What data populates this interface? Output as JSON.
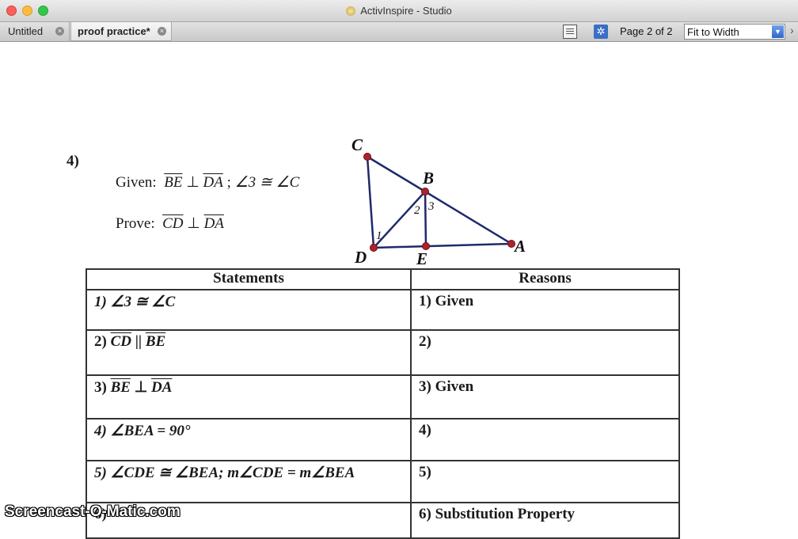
{
  "window": {
    "title": "ActivInspire - Studio"
  },
  "tabs": [
    {
      "label": "Untitled"
    },
    {
      "label": "proof practice*"
    }
  ],
  "toolbar": {
    "page_label": "Page 2 of 2",
    "zoom_value": "Fit to Width"
  },
  "worksheet": {
    "problem_number": "4)",
    "given": {
      "label": "Given:",
      "seg1": "BE",
      "perp": "⊥",
      "seg2": "DA",
      "sep": ";",
      "angle": "∠3 ≅ ∠C"
    },
    "prove": {
      "label": "Prove:",
      "seg1": "CD",
      "perp": "⊥",
      "seg2": "DA"
    },
    "diagram": {
      "vertex_labels": [
        "C",
        "B",
        "A",
        "D",
        "E"
      ],
      "angle_labels": [
        "1",
        "2",
        "3"
      ]
    },
    "table": {
      "headers": [
        "Statements",
        "Reasons"
      ],
      "rows": [
        {
          "statement": "1)  ∠3 ≅ ∠C",
          "reason": "1)  Given"
        },
        {
          "statement_num": "2)",
          "statement_seg1": "CD",
          "statement_mid": " || ",
          "statement_seg2": "BE",
          "reason": "2)"
        },
        {
          "statement_num": "3)",
          "statement_seg1": "BE",
          "statement_mid": " ⊥ ",
          "statement_seg2": "DA",
          "reason": "3)  Given"
        },
        {
          "statement": "4)  ∠BEA = 90°",
          "reason": "4)"
        },
        {
          "statement": "5)  ∠CDE ≅ ∠BEA; m∠CDE = m∠BEA",
          "reason": "5)"
        },
        {
          "statement": "6)",
          "reason": "6)  Substitution Property"
        }
      ]
    }
  },
  "watermark": "Screencast-O-Matic.com",
  "colors": {
    "point_red": "#b0232a",
    "line_navy": "#1f2a6b"
  }
}
